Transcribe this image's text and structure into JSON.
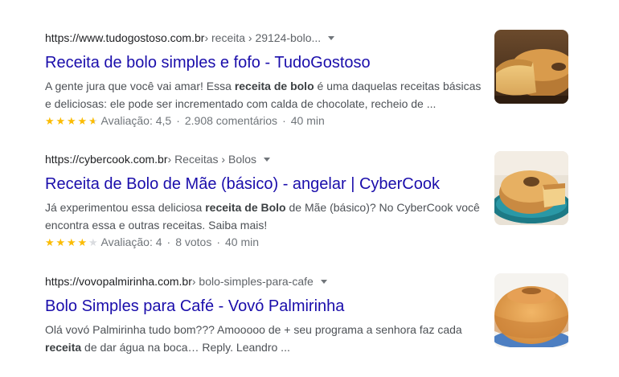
{
  "results": [
    {
      "cite_domain": "https://www.tudogostoso.com.br",
      "cite_path": " › receita › 29124-bolo...",
      "title": "Receita de bolo simples e fofo - TudoGostoso",
      "snippet": [
        "A gente jura que você vai amar! Essa ",
        "receita de bolo",
        " é uma daquelas receitas básicas e deliciosas: ele pode ser incrementado com calda de chocolate, recheio de ..."
      ],
      "rating": {
        "stars": 4.5,
        "text": "Avaliação: 4,5",
        "reviews": "2.908 comentários",
        "time": "40 min"
      },
      "thumbnail": "bundt-cake-slice-image"
    },
    {
      "cite_domain": "https://cybercook.com.br",
      "cite_path": " › Receitas › Bolos",
      "title": "Receita de Bolo de Mãe (básico) - angelar | CyberCook",
      "snippet": [
        "Já experimentou essa deliciosa ",
        "receita de Bolo",
        " de Mãe (básico)? No CyberCook você encontra essa e outras receitas. Saiba mais!"
      ],
      "rating": {
        "stars": 4,
        "text": "Avaliação: 4",
        "reviews": "8 votos",
        "time": "40 min"
      },
      "thumbnail": "cake-on-blue-plate-image"
    },
    {
      "cite_domain": "https://vovopalmirinha.com.br",
      "cite_path": " › bolo-simples-para-cafe",
      "title": "Bolo Simples para Café - Vovó Palmirinha",
      "snippet": [
        "Olá vovó Palmirinha tudo bom??? Amooooo de + seu programa a senhora faz cada ",
        "receita",
        " de dar água na boca… Reply. Leandro ..."
      ],
      "thumbnail": "ring-cake-image"
    }
  ],
  "colors": {
    "link": "#1a0dab",
    "star": "#fbbc04",
    "star_empty": "#dadce0",
    "text": "#4d5156"
  }
}
